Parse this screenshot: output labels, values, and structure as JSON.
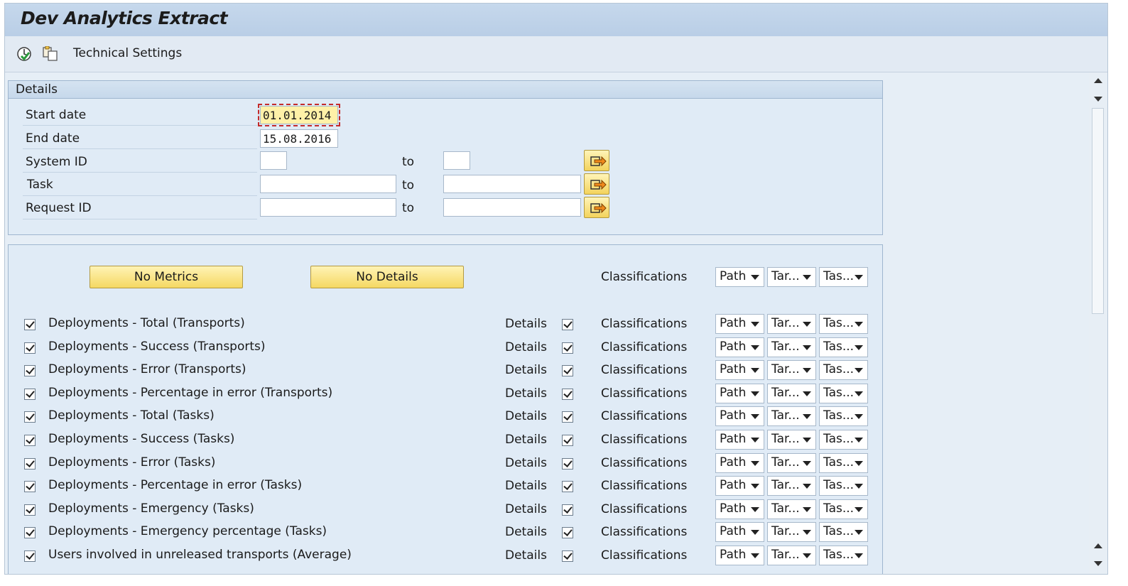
{
  "app": {
    "title": "Dev Analytics Extract"
  },
  "toolbar": {
    "execute_icon": "execute-icon",
    "variant_icon": "variant-icon",
    "technical_settings_label": "Technical Settings"
  },
  "details": {
    "title": "Details",
    "start_date": {
      "label": "Start date",
      "value": "01.01.2014"
    },
    "end_date": {
      "label": "End date",
      "value": "15.08.2016"
    },
    "system_id": {
      "label": "System ID",
      "from": "",
      "to": "",
      "to_label": "to"
    },
    "task": {
      "label": "Task",
      "from": "",
      "to": "",
      "to_label": "to"
    },
    "request_id": {
      "label": "Request ID",
      "from": "",
      "to": "",
      "to_label": "to"
    }
  },
  "options": {
    "no_metrics_label": "No Metrics",
    "no_details_label": "No Details",
    "classifications_label": "Classifications",
    "header_dropdowns": [
      "Path",
      "Tar...",
      "Tas..."
    ],
    "details_label": "Details",
    "rows": [
      {
        "label": "Deployments - Total (Transports)",
        "checked": true,
        "details_checked": true
      },
      {
        "label": "Deployments - Success (Transports)",
        "checked": true,
        "details_checked": true
      },
      {
        "label": "Deployments - Error (Transports)",
        "checked": true,
        "details_checked": true
      },
      {
        "label": "Deployments - Percentage in error (Transports)",
        "checked": true,
        "details_checked": true
      },
      {
        "label": "Deployments - Total (Tasks)",
        "checked": true,
        "details_checked": true
      },
      {
        "label": "Deployments - Success (Tasks)",
        "checked": true,
        "details_checked": true
      },
      {
        "label": "Deployments - Error (Tasks)",
        "checked": true,
        "details_checked": true
      },
      {
        "label": "Deployments - Percentage in error (Tasks)",
        "checked": true,
        "details_checked": true
      },
      {
        "label": "Deployments - Emergency (Tasks)",
        "checked": true,
        "details_checked": true
      },
      {
        "label": "Deployments - Emergency percentage (Tasks)",
        "checked": true,
        "details_checked": true
      },
      {
        "label": "Users involved in unreleased transports (Average)",
        "checked": true,
        "details_checked": true
      }
    ]
  },
  "colors": {
    "title_bar": "#c6d8ec",
    "button_yellow": "#f5d862",
    "group_bg": "#e0ebf6"
  }
}
